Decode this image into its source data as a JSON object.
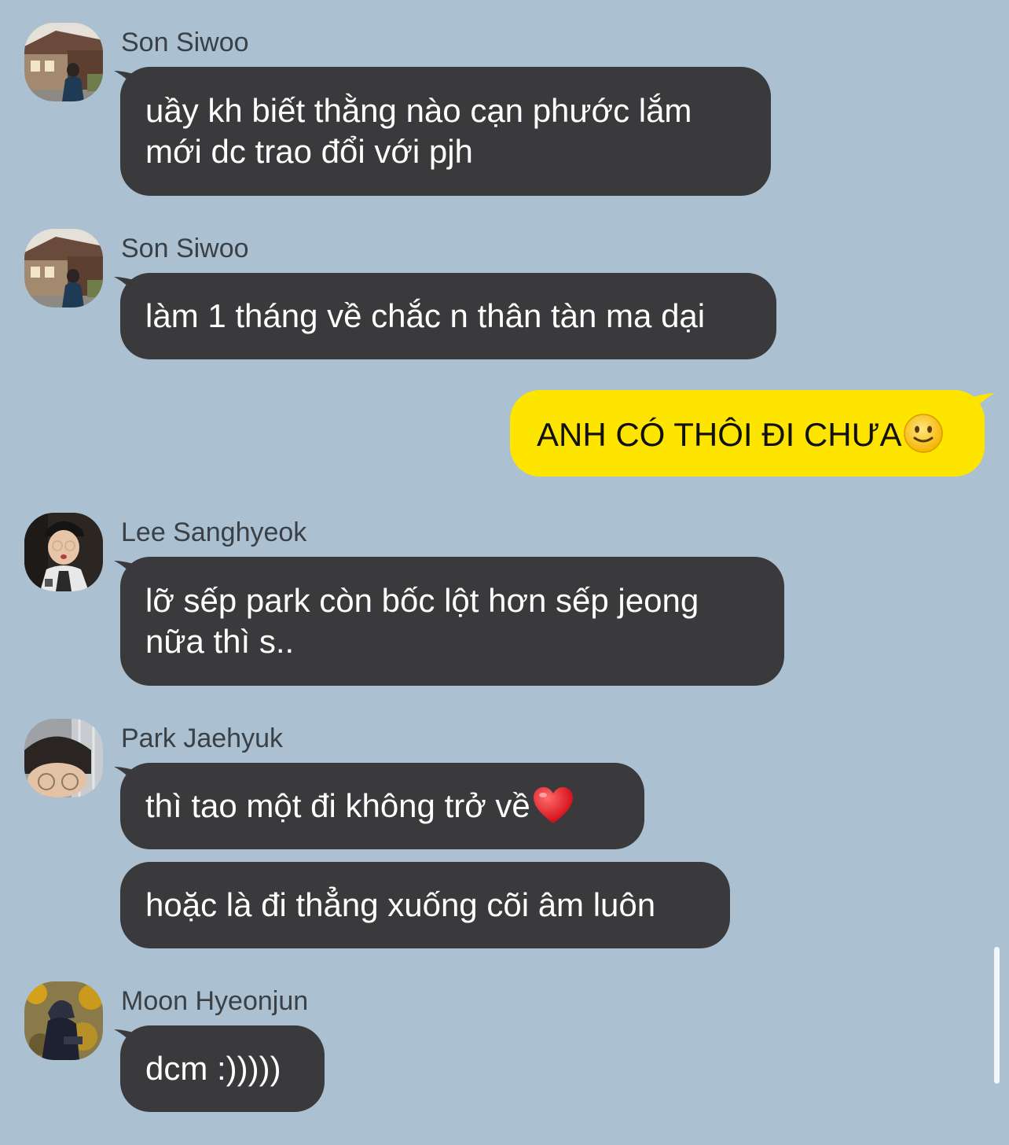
{
  "chat": {
    "messages": [
      {
        "sender": "Son Siwoo",
        "avatar": "avatar-son-siwoo",
        "lines": [
          "uầy kh biết thằng nào cạn phước lắm",
          "mới dc trao đổi với pjh"
        ]
      },
      {
        "sender": "Son Siwoo",
        "avatar": "avatar-son-siwoo",
        "lines": [
          "làm 1 tháng về chắc n thân tàn ma dại"
        ]
      },
      {
        "sender": "me",
        "text": "ANH CÓ THÔI ĐI CHƯA",
        "emoji": "slightly-smiling-face-emoji"
      },
      {
        "sender": "Lee Sanghyeok",
        "avatar": "avatar-lee-sanghyeok",
        "lines": [
          "lỡ sếp park còn bốc lột hơn sếp jeong",
          "nữa thì s.."
        ]
      },
      {
        "sender": "Park Jaehyuk",
        "avatar": "avatar-park-jaehyuk",
        "text": "thì tao một đi không trở về",
        "emoji": "red-heart-emoji"
      },
      {
        "sender": "Park Jaehyuk",
        "text": "hoặc là đi thẳng xuống cõi âm luôn"
      },
      {
        "sender": "Moon Hyeonjun",
        "avatar": "avatar-moon-hyeonjun",
        "text": "dcm :)))))"
      }
    ]
  },
  "colors": {
    "background": "#abc1d1",
    "incoming_bubble": "#3a3a3c",
    "outgoing_bubble": "#fee500",
    "sender_name": "#3a4045"
  }
}
